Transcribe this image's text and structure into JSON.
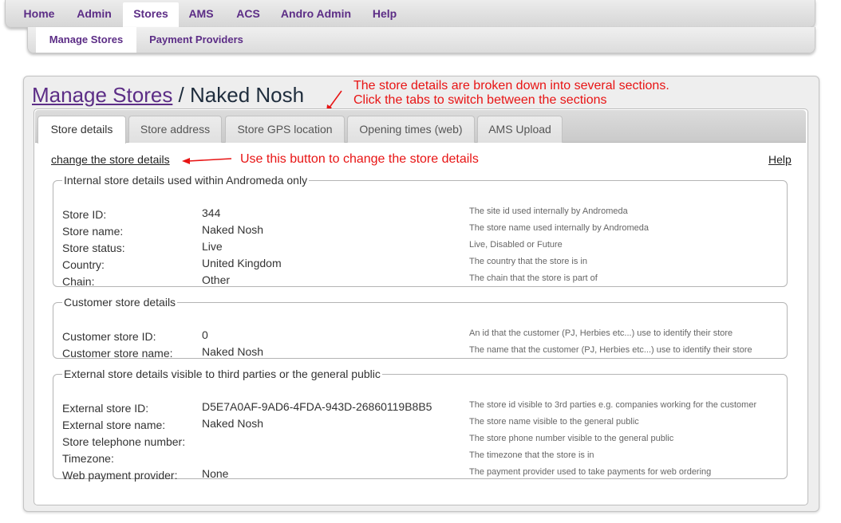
{
  "topnav": {
    "items": [
      "Home",
      "Admin",
      "Stores",
      "AMS",
      "ACS",
      "Andro Admin",
      "Help"
    ],
    "active": "Stores"
  },
  "subnav": {
    "items": [
      "Manage Stores",
      "Payment Providers"
    ],
    "active": "Manage Stores"
  },
  "title": {
    "link": "Manage Stores",
    "separator": " / ",
    "store": "Naked Nosh"
  },
  "annotations": {
    "tabs_line1": "The store details are broken down into several sections.",
    "tabs_line2": "Click the tabs to switch between the sections",
    "button": "Use this button to change the store details",
    "color": "#e81414"
  },
  "tabs": [
    "Store details",
    "Store address",
    "Store GPS location",
    "Opening times (web)",
    "AMS Upload"
  ],
  "active_tab": "Store details",
  "links": {
    "change": "change the store details",
    "help": "Help"
  },
  "sections": {
    "internal": {
      "legend": "Internal store details used within Andromeda only",
      "rows": [
        {
          "label": "Store ID:",
          "value": "344",
          "desc": "The site id used internally by Andromeda"
        },
        {
          "label": "Store name:",
          "value": "Naked Nosh",
          "desc": "The store name used internally by Andromeda"
        },
        {
          "label": "Store status:",
          "value": "Live",
          "desc": "Live, Disabled or Future"
        },
        {
          "label": "Country:",
          "value": "United Kingdom",
          "desc": "The country that the store is in"
        },
        {
          "label": "Chain:",
          "value": "Other",
          "desc": "The chain that the store is part of"
        }
      ]
    },
    "customer": {
      "legend": "Customer store details",
      "rows": [
        {
          "label": "Customer store ID:",
          "value": "0",
          "desc": "An id that the customer (PJ, Herbies etc...) use to identify their store"
        },
        {
          "label": "Customer store name:",
          "value": "Naked Nosh",
          "desc": "The name that the customer (PJ, Herbies etc...) use to identify their store"
        }
      ]
    },
    "external": {
      "legend": "External store details visible to third parties or the general public",
      "rows": [
        {
          "label": "External store ID:",
          "value": "D5E7A0AF-9AD6-4FDA-943D-26860119B8B5",
          "desc": "The store id visible to 3rd parties e.g. companies working for the customer"
        },
        {
          "label": "External store name:",
          "value": "Naked Nosh",
          "desc": "The store name visible to the general public"
        },
        {
          "label": "Store telephone number:",
          "value": "",
          "desc": "The store phone number visible to the general public"
        },
        {
          "label": "Timezone:",
          "value": "",
          "desc": "The timezone that the store is in"
        },
        {
          "label": "Web payment provider:",
          "value": "None",
          "desc": "The payment provider used to take payments for web ordering"
        }
      ]
    }
  }
}
